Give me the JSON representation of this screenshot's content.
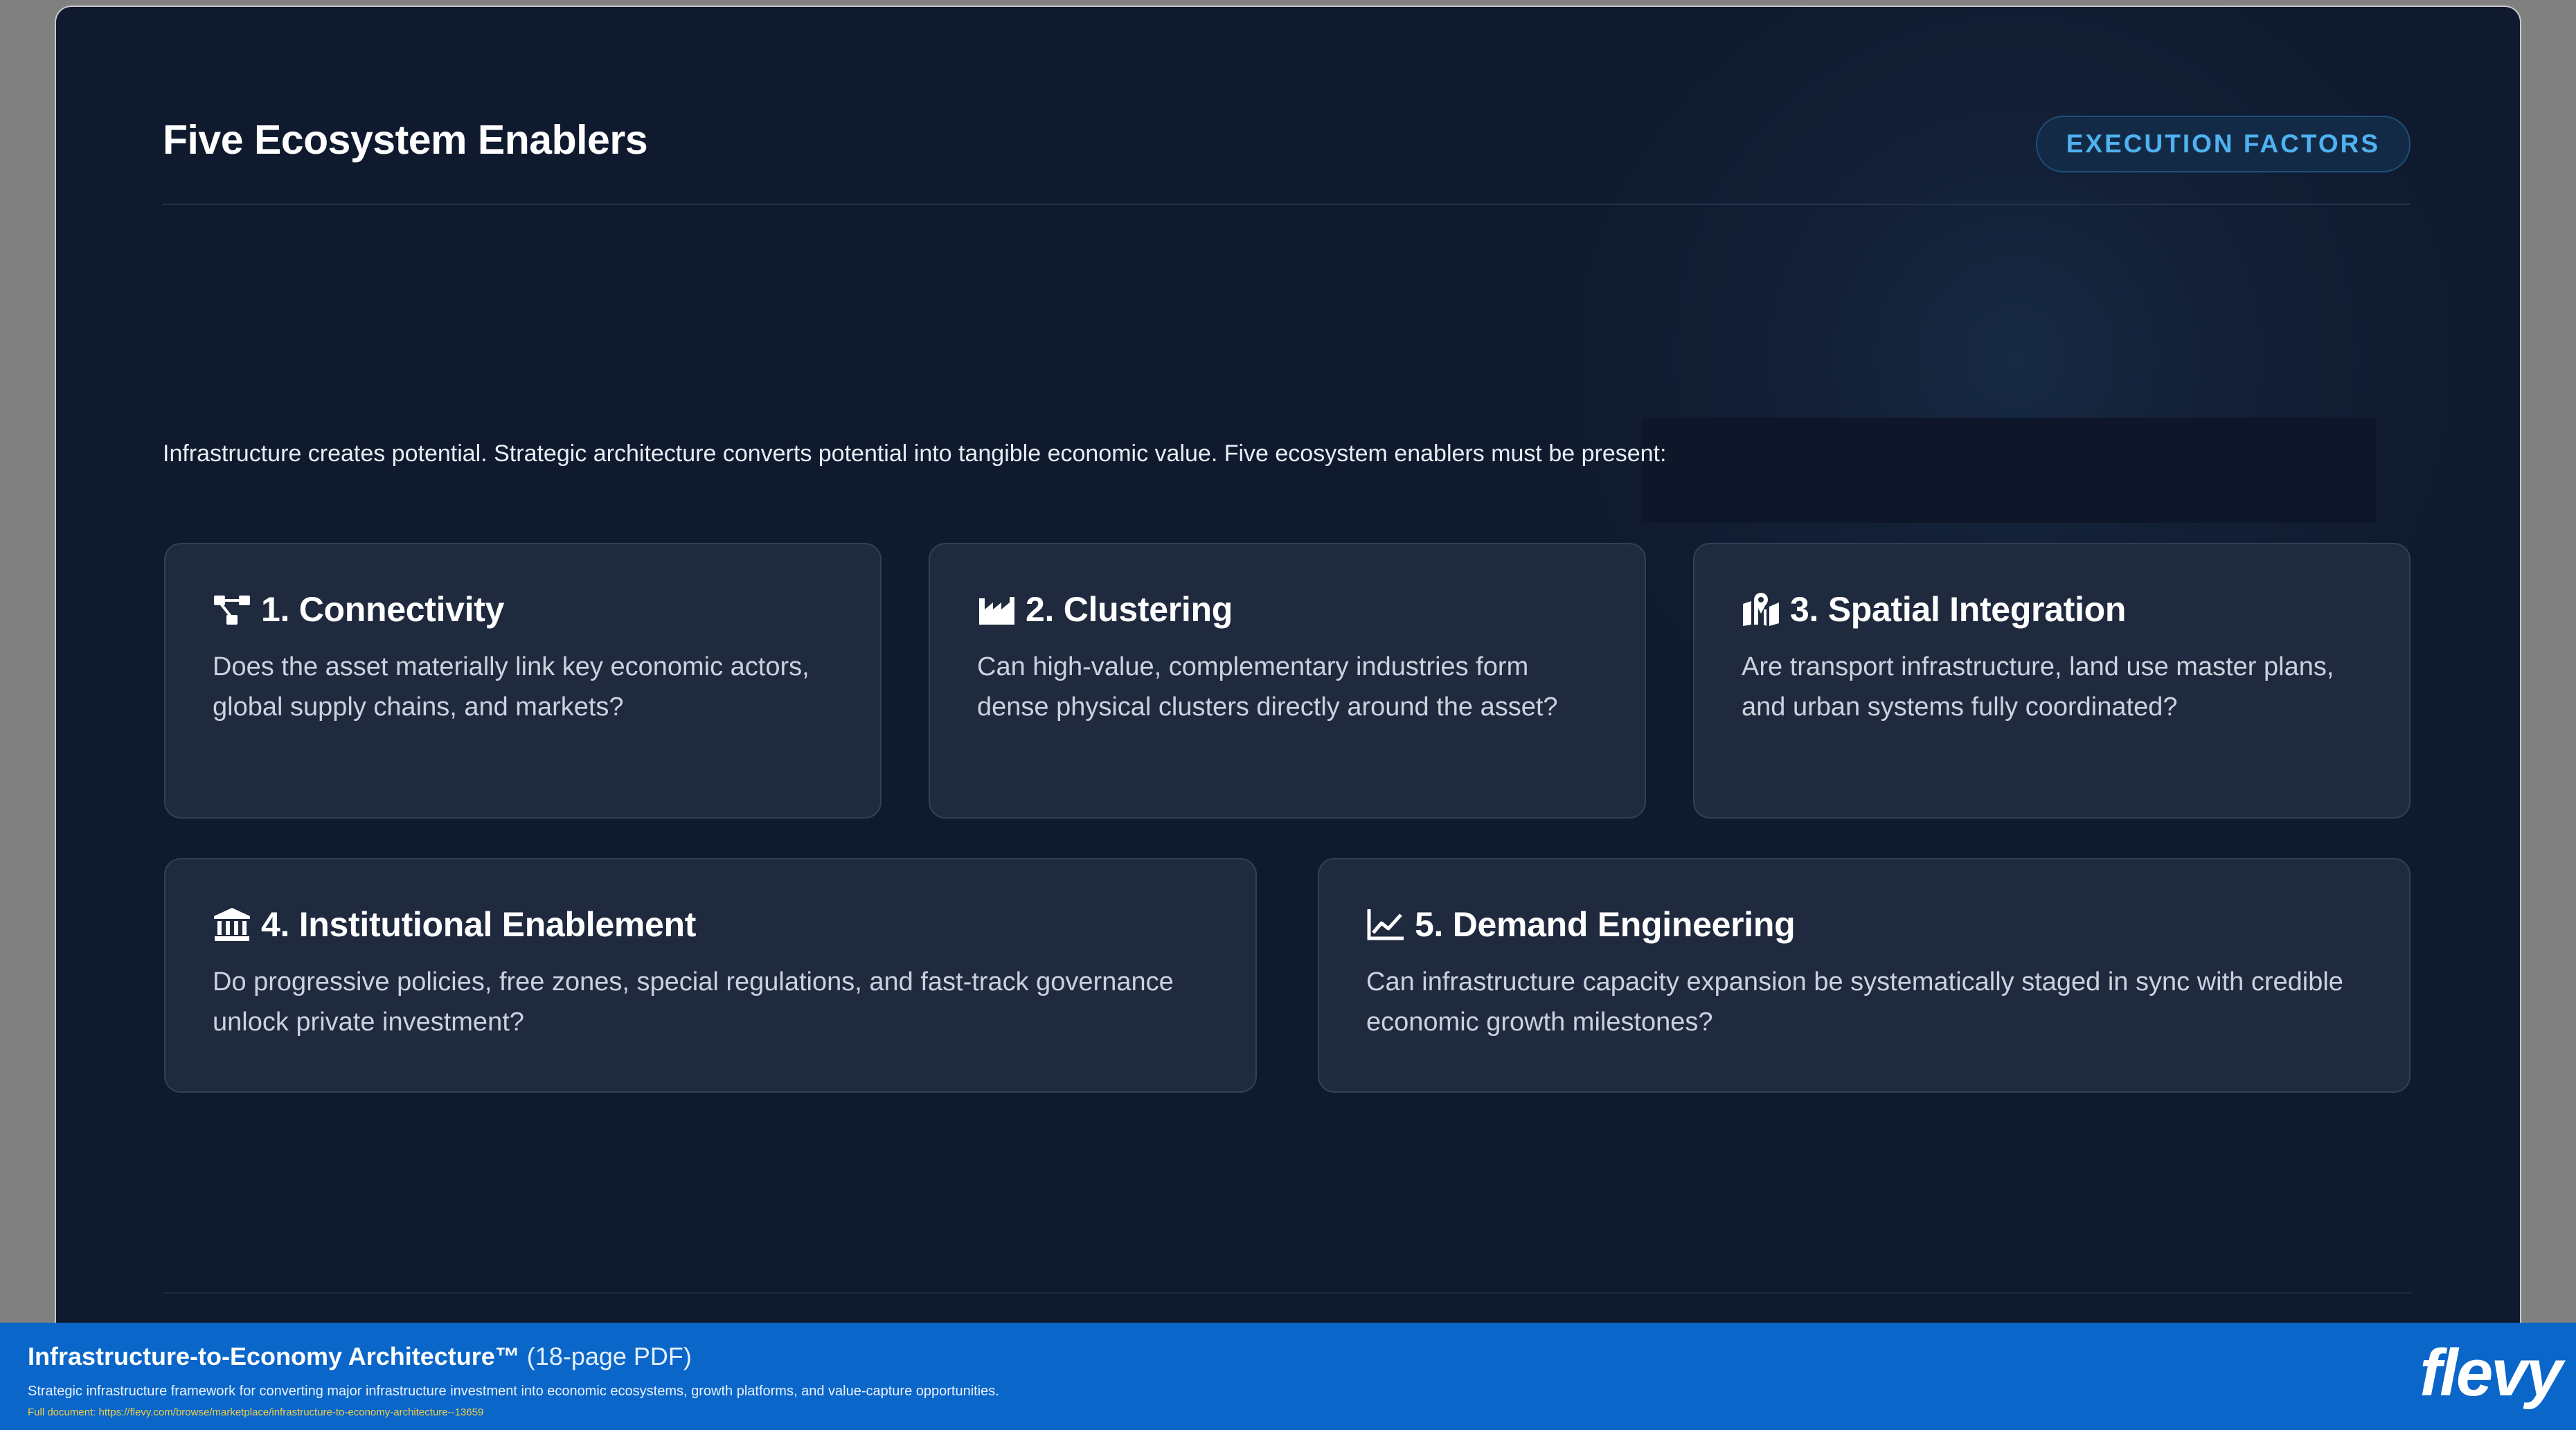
{
  "slide": {
    "title": "Five Ecosystem Enablers",
    "badge": "EXECUTION FACTORS",
    "intro": "Infrastructure creates potential. Strategic architecture converts potential into tangible economic value. Five ecosystem enablers must be present:"
  },
  "cards": [
    {
      "icon": "network-icon",
      "title": "1. Connectivity",
      "text": "Does the asset materially link key economic actors, global supply chains, and markets?"
    },
    {
      "icon": "industry-icon",
      "title": "2. Clustering",
      "text": "Can high-value, complementary industries form dense physical clusters directly around the asset?"
    },
    {
      "icon": "map-location-icon",
      "title": "3. Spatial Integration",
      "text": "Are transport infrastructure, land use master plans, and urban systems fully coordinated?"
    },
    {
      "icon": "landmark-icon",
      "title": "4. Institutional Enablement",
      "text": "Do progressive policies, free zones, special regulations, and fast-track governance unlock private investment?"
    },
    {
      "icon": "chart-line-icon",
      "title": "5. Demand Engineering",
      "text": "Can infrastructure capacity expansion be systematically staged in sync with credible economic growth milestones?"
    }
  ],
  "footer": {
    "title": "Infrastructure-to-Economy Architecture™",
    "pages": "(18-page PDF)",
    "description": "Strategic infrastructure framework for converting major infrastructure investment into economic ecosystems, growth platforms, and value-capture opportunities.",
    "link": "Full document: https://flevy.com/browse/marketplace/infrastructure-to-economy-architecture--13659",
    "logo": "flevy"
  },
  "colors": {
    "background": "#101a2e",
    "card": "#1f2a3e",
    "badge_text": "#4fb2f0",
    "footer": "#0a66c8"
  }
}
